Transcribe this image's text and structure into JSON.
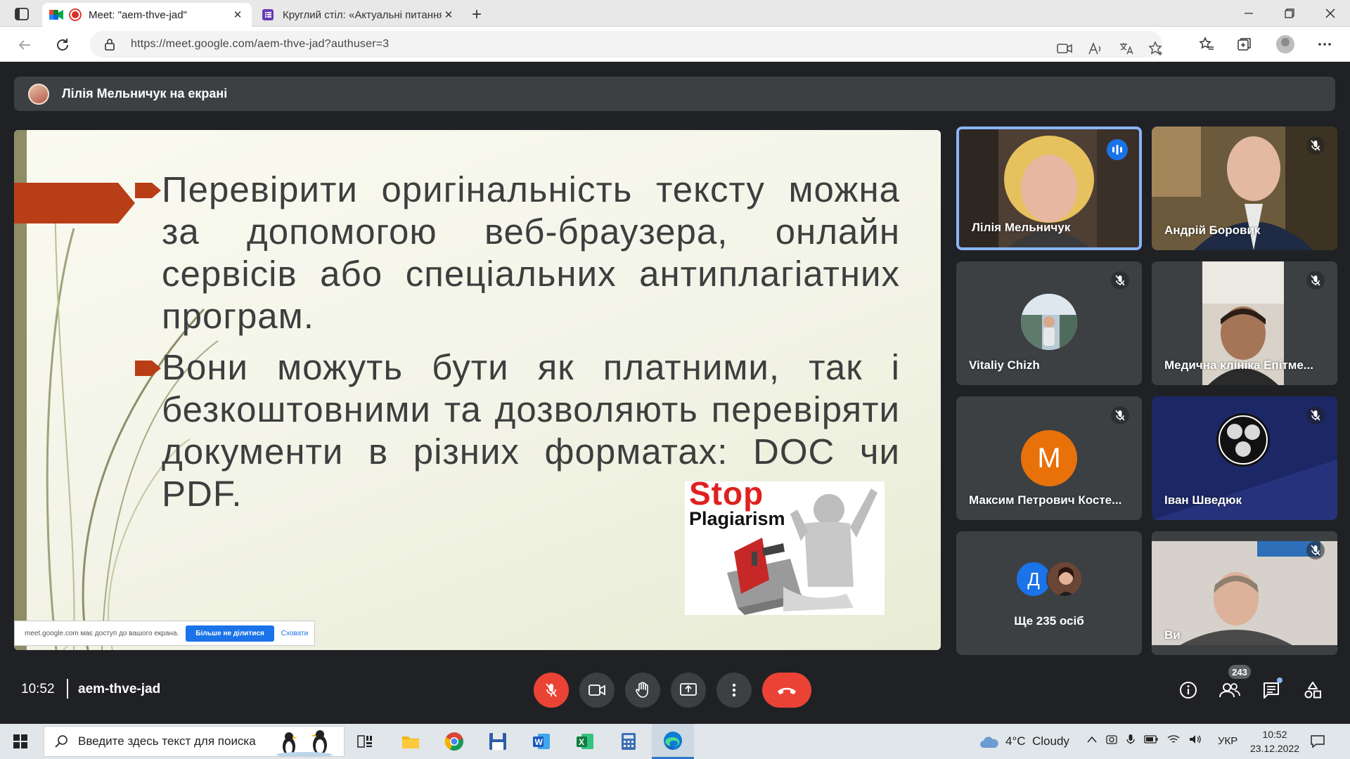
{
  "browser": {
    "tabs": [
      {
        "title": "Meet: \"aem-thve-jad\"",
        "active": true
      },
      {
        "title": "Круглий стіл: «Актуальні питання",
        "active": false
      }
    ],
    "url": "https://meet.google.com/aem-thve-jad?authuser=3"
  },
  "presenter": {
    "text": "Лілія Мельничук на екрані"
  },
  "slide": {
    "bullet1": "Перевірити оригінальність тексту можна за допомогою веб-браузера, онлайн сервісів або спеціальних антиплагіатних програм.",
    "bullet2": "Вони можуть бути як платними, так і безкоштовними та дозволяють перевіряти документи в різних форматах: DOC чи PDF.",
    "stop_word": "Stop",
    "plagiarism_word": "Plagiarism"
  },
  "share_notice": {
    "message": "meet.google.com має доступ до вашого екрана.",
    "stop_label": "Більше не ділитися",
    "hide_label": "Сховати"
  },
  "participants": {
    "items": [
      {
        "name": "Лілія Мельничук",
        "speaking": true,
        "muted": false
      },
      {
        "name": "Андрій Боровик",
        "speaking": false,
        "muted": true
      },
      {
        "name": "Vitaliy Chizh",
        "speaking": false,
        "muted": true,
        "avatar_only": true
      },
      {
        "name": "Медична клініка Епітме...",
        "speaking": false,
        "muted": true
      },
      {
        "name": "Максим Петрович Косте...",
        "speaking": false,
        "muted": true,
        "initial": "M",
        "avatar_color": "#e8710a"
      },
      {
        "name": "Іван Шведюк",
        "speaking": false,
        "muted": true
      },
      {
        "name": "Ще 235 осіб",
        "more": true,
        "initial": "Д",
        "avatar_color": "#1a73e8"
      },
      {
        "name": "Ви",
        "speaking": false,
        "muted": true
      }
    ]
  },
  "meeting": {
    "time": "10:52",
    "code": "aem-thve-jad",
    "people_count": "243"
  },
  "taskbar": {
    "search_placeholder": "Введите здесь текст для поиска",
    "weather": "4°C  Cloudy",
    "language": "УКР",
    "time": "10:52",
    "date": "23.12.2022"
  }
}
